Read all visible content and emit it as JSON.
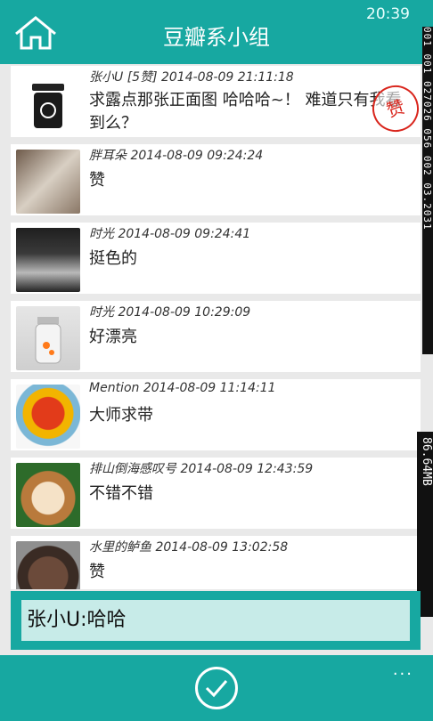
{
  "header": {
    "title": "豆瓣系小组",
    "clock": "20:39"
  },
  "posts": [
    {
      "meta": "张小U [5赞] 2014-08-09 21:11:18",
      "content": "求露点那张正面图   哈哈哈~！ 难道只有我看到么？",
      "avatar": "recycle-bin-avatar",
      "stamp": "赞"
    },
    {
      "meta": "胖耳朵 2014-08-09 09:24:24",
      "content": "赞",
      "avatar": "cat-avatar"
    },
    {
      "meta": "时光 2014-08-09 09:24:41",
      "content": "挺色的",
      "avatar": "tea-avatar"
    },
    {
      "meta": "时光 2014-08-09 10:29:09",
      "content": "好漂亮",
      "avatar": "jar-avatar"
    },
    {
      "meta": "Mention 2014-08-09 11:14:11",
      "content": "大师求带",
      "avatar": "flower-avatar"
    },
    {
      "meta": "排山倒海感叹号 2014-08-09 12:43:59",
      "content": "不错不错",
      "avatar": "dog-avatar"
    },
    {
      "meta": "水里的鲈鱼 2014-08-09 13:02:58",
      "content": "赞",
      "avatar": "man-avatar"
    }
  ],
  "compose": {
    "value": "张小U:哈哈"
  },
  "appbar": {
    "more_label": "..."
  },
  "debug": {
    "counter_strip": "001 001 027026 056 002 03.2031",
    "memory": "86.64MB"
  },
  "colors": {
    "accent": "#17a8a1",
    "input_bg": "#c7ebe8",
    "stamp": "#d9251c"
  }
}
